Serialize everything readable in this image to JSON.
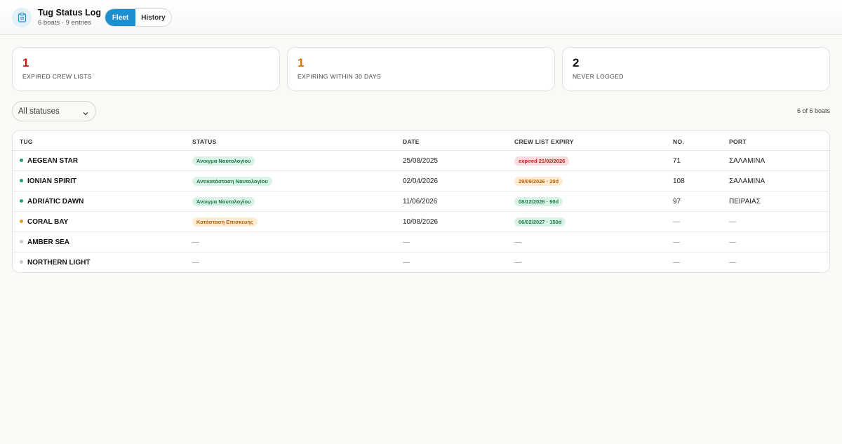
{
  "app": {
    "title": "Tug Status Log",
    "subtitle": "6 boats · 9 entries",
    "tabs": [
      {
        "label": "Fleet",
        "active": true
      },
      {
        "label": "History",
        "active": false
      }
    ],
    "accent": "#1d8fcf"
  },
  "summary": [
    {
      "value": "1",
      "label": "EXPIRED CREW LISTS",
      "color": "#c41c1c"
    },
    {
      "value": "1",
      "label": "EXPIRING WITHIN 30 DAYS",
      "color": "#d27413"
    },
    {
      "value": "2",
      "label": "NEVER LOGGED",
      "color": "#111111"
    }
  ],
  "filter": {
    "selected": "All statuses"
  },
  "count_text": "6 of 6 boats",
  "table": {
    "columns": [
      "TUG",
      "STATUS",
      "DATE",
      "CREW LIST EXPIRY",
      "NO.",
      "PORT"
    ],
    "rows": [
      {
        "tug": "AEGEAN STAR",
        "dot": "#22a06b",
        "status": "Άνοιγμα Ναυτολογίου",
        "status_tone": "green",
        "date": "25/08/2025",
        "expiry": "expired 21/02/2026",
        "expiry_tone": "red",
        "no": "71",
        "port": "ΣΑΛΑΜΙΝΑ"
      },
      {
        "tug": "IONIAN SPIRIT",
        "dot": "#22a06b",
        "status": "Αντικατάσταση Ναυτολογίου",
        "status_tone": "green",
        "date": "02/04/2026",
        "expiry": "29/09/2026 · 20d",
        "expiry_tone": "orange",
        "no": "108",
        "port": "ΣΑΛΑΜΙΝΑ"
      },
      {
        "tug": "ADRIATIC DAWN",
        "dot": "#22a06b",
        "status": "Άνοιγμα Ναυτολογίου",
        "status_tone": "green",
        "date": "11/06/2026",
        "expiry": "08/12/2026 · 90d",
        "expiry_tone": "green",
        "no": "97",
        "port": "ΠΕΙΡΑΙΑΣ"
      },
      {
        "tug": "CORAL BAY",
        "dot": "#e0a020",
        "status": "Κατάσταση Επισκευής",
        "status_tone": "orange",
        "date": "10/08/2026",
        "expiry": "06/02/2027 · 150d",
        "expiry_tone": "green",
        "no": "—",
        "port": "—"
      },
      {
        "tug": "AMBER SEA",
        "dot": "#c8c8c8",
        "status": "—",
        "status_tone": "",
        "date": "—",
        "expiry": "—",
        "expiry_tone": "",
        "no": "—",
        "port": "—"
      },
      {
        "tug": "NORTHERN LIGHT",
        "dot": "#c8c8c8",
        "status": "—",
        "status_tone": "",
        "date": "—",
        "expiry": "—",
        "expiry_tone": "",
        "no": "—",
        "port": "—"
      }
    ]
  }
}
